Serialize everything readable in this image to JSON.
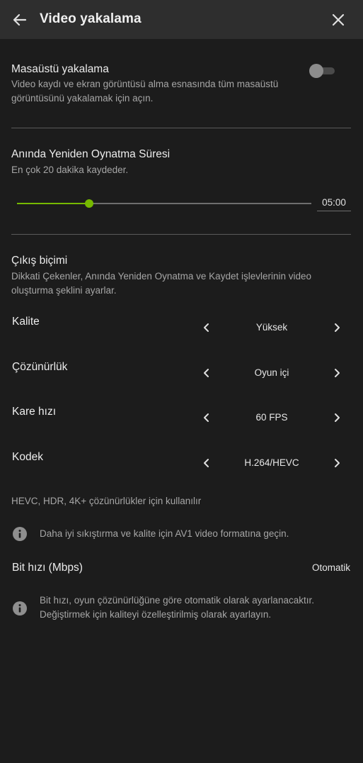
{
  "header": {
    "title": "Video yakalama",
    "back_icon": "arrow-left-icon",
    "close_icon": "close-icon"
  },
  "desktop_capture": {
    "title": "Masaüstü yakalama",
    "description": "Video kaydı ve ekran görüntüsü alma esnasında tüm masaüstü görüntüsünü yakalamak için açın.",
    "enabled": false
  },
  "instant_replay": {
    "title": "Anında Yeniden Oynatma Süresi",
    "description": "En çok 20 dakika kaydeder.",
    "value": "05:00",
    "slider_fraction": 0.245
  },
  "output_format": {
    "title": "Çıkış biçimi",
    "description": "Dikkati Çekenler, Anında Yeniden Oynatma ve Kaydet işlevlerinin video oluşturma şeklini ayarlar.",
    "rows": [
      {
        "label": "Kalite",
        "value": "Yüksek"
      },
      {
        "label": "Çözünürlük",
        "value": "Oyun içi"
      },
      {
        "label": "Kare hızı",
        "value": "60 FPS"
      },
      {
        "label": "Kodek",
        "value": "H.264/HEVC"
      }
    ],
    "codec_note": "HEVC, HDR, 4K+ çözünürlükler için kullanılır",
    "av1_info": "Daha iyi sıkıştırma ve kalite için AV1 video formatına geçin.",
    "bitrate_label": "Bit hızı (Mbps)",
    "bitrate_value": "Otomatik",
    "bitrate_info": "Bit hızı, oyun çözünürlüğüne göre otomatik olarak ayarlanacaktır. Değiştirmek için kaliteyi özelleştirilmiş olarak ayarlayın."
  },
  "colors": {
    "accent": "#76b900",
    "background": "#1c1c1c",
    "header": "#2e2e2e"
  }
}
